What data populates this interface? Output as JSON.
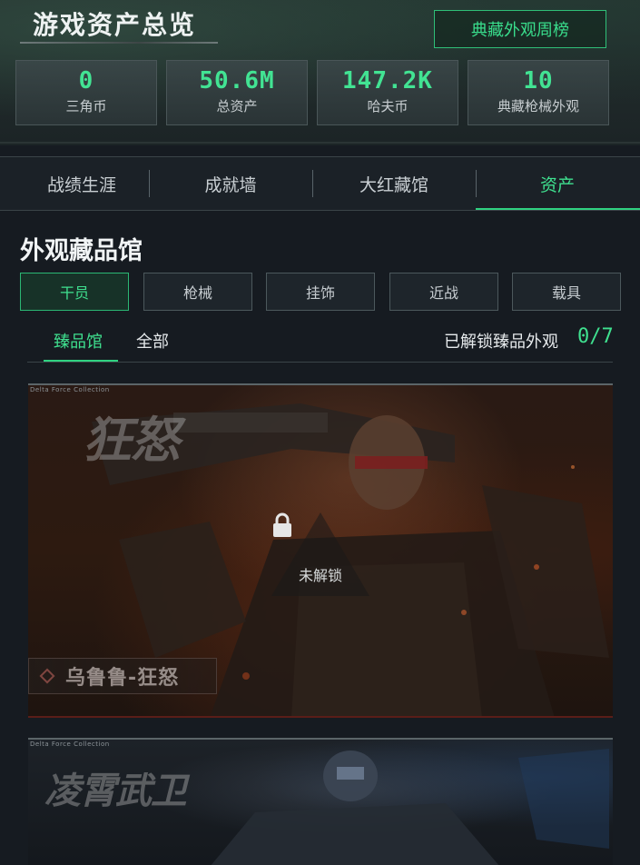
{
  "header": {
    "title": "游戏资产总览",
    "weekly_button": "典藏外观周榜",
    "stats": [
      {
        "value": "0",
        "label": "三角币"
      },
      {
        "value": "50.6M",
        "label": "总资产"
      },
      {
        "value": "147.2K",
        "label": "哈夫币"
      },
      {
        "value": "10",
        "label": "典藏枪械外观"
      }
    ]
  },
  "tabs": [
    {
      "label": "战绩生涯",
      "active": false
    },
    {
      "label": "成就墙",
      "active": false
    },
    {
      "label": "大红藏馆",
      "active": false
    },
    {
      "label": "资产",
      "active": true
    }
  ],
  "gallery": {
    "title": "外观藏品馆",
    "categories": [
      {
        "label": "干员",
        "active": true
      },
      {
        "label": "枪械",
        "active": false
      },
      {
        "label": "挂饰",
        "active": false
      },
      {
        "label": "近战",
        "active": false
      },
      {
        "label": "载具",
        "active": false
      }
    ],
    "subtabs": [
      {
        "label": "臻品馆",
        "active": true
      },
      {
        "label": "全部",
        "active": false
      }
    ],
    "unlock_label": "已解锁臻品外观",
    "unlock_count": "0/7",
    "cards": [
      {
        "logo": "狂怒",
        "lock_text": "未解锁",
        "name": "乌鲁鲁-狂怒",
        "tag": "Delta Force Collection"
      },
      {
        "logo": "凌霄武卫",
        "tag": "Delta Force Collection"
      }
    ]
  },
  "colors": {
    "accent": "#3fe08f",
    "background": "#161b21"
  }
}
